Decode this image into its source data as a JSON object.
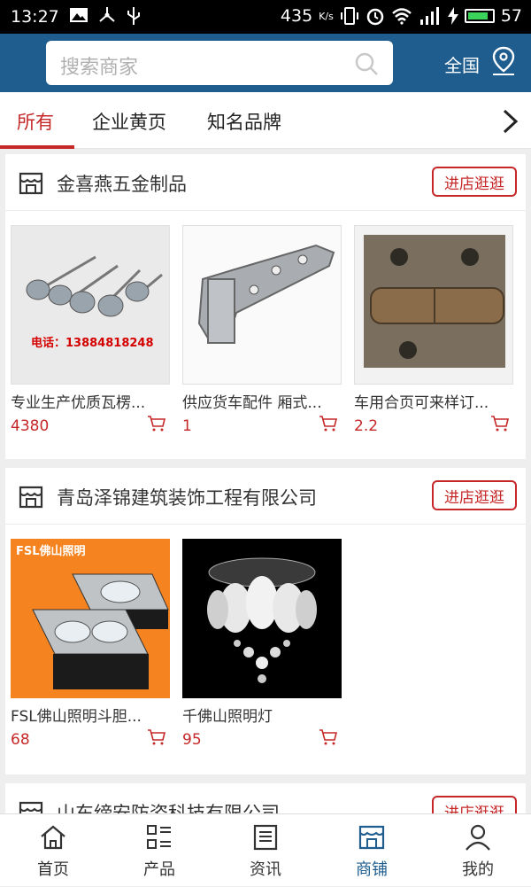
{
  "status_bar": {
    "time": "13:27",
    "speed": "435",
    "speed_unit": "K/s",
    "battery": "57"
  },
  "search": {
    "placeholder": "搜索商家"
  },
  "region": "全国",
  "tabs": [
    "所有",
    "企业黄页",
    "知名品牌"
  ],
  "stores": [
    {
      "name": "金喜燕五金制品",
      "visit_label": "进店逛逛",
      "products": [
        {
          "name": "专业生产优质瓦楞...",
          "price": "4380",
          "image_text": "电话：13884818248"
        },
        {
          "name": "供应货车配件 厢式...",
          "price": "1"
        },
        {
          "name": "车用合页可来样订...",
          "price": "2.2"
        }
      ]
    },
    {
      "name": "青岛泽锦建筑装饰工程有限公司",
      "visit_label": "进店逛逛",
      "products": [
        {
          "name": "FSL佛山照明斗胆...",
          "price": "68",
          "image_text": "FSL佛山照明"
        },
        {
          "name": "千佛山照明灯",
          "price": "95"
        }
      ]
    },
    {
      "name": "山东缔安防姿科技有限公司",
      "visit_label": "进店逛逛"
    }
  ],
  "bottom_nav": [
    "首页",
    "产品",
    "资讯",
    "商铺",
    "我的"
  ],
  "colors": {
    "primary": "#1e5d8e",
    "accent": "#c62828"
  }
}
